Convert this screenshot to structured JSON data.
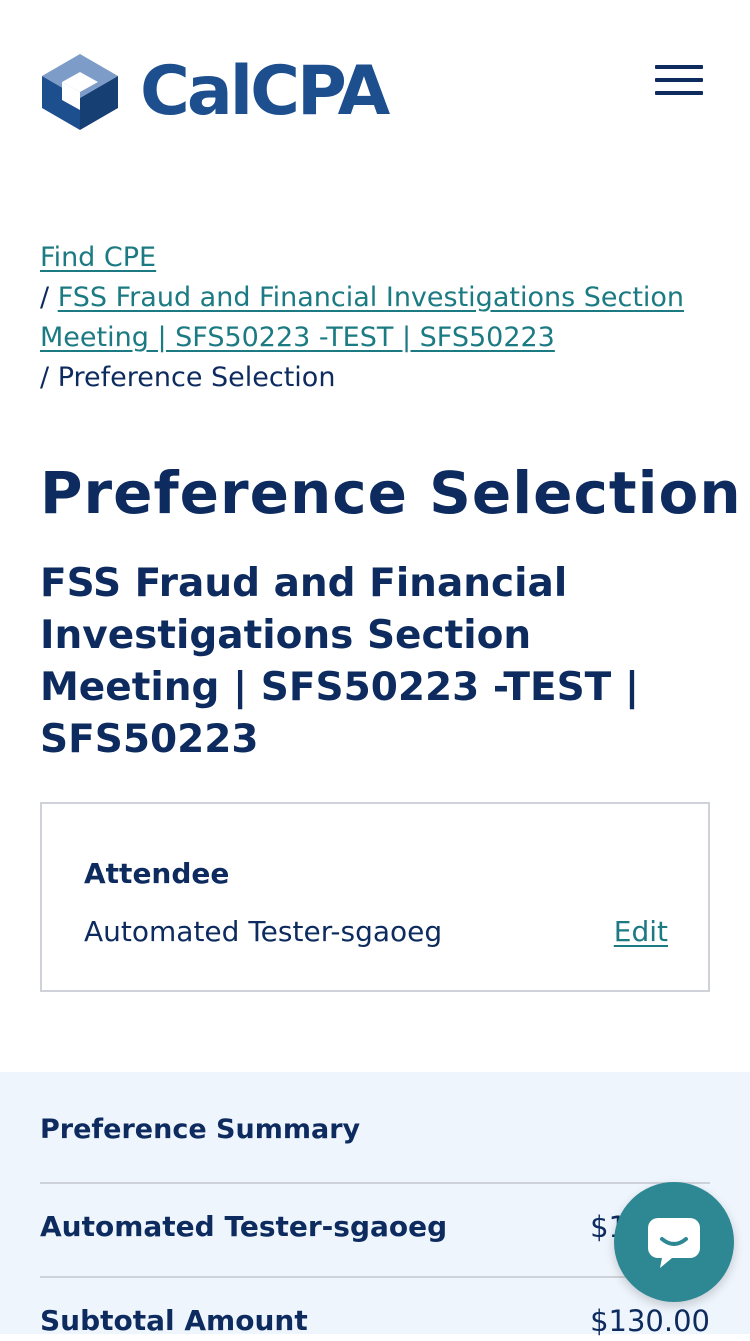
{
  "brand": {
    "name": "CalCPA",
    "logo_icon": "isometric-cube-logo",
    "primary_color": "#1d4f8f",
    "dark_text_color": "#0d2b5e",
    "link_color": "#1b7a82"
  },
  "header": {
    "menu_icon": "hamburger-menu-icon"
  },
  "breadcrumb": {
    "items": [
      {
        "label": "Find CPE",
        "is_link": true
      },
      {
        "label": "FSS Fraud and Financial Investigations Section Meeting | SFS50223 -TEST | SFS50223",
        "is_link": true
      },
      {
        "label": "Preference Selection",
        "is_link": false
      }
    ],
    "separator": "/"
  },
  "page": {
    "title": "Preference Selection",
    "event_title": "FSS Fraud and Financial Investigations Section Meeting | SFS50223 -TEST | SFS50223"
  },
  "attendee": {
    "heading": "Attendee",
    "name": "Automated Tester-sgaoeg",
    "edit_label": "Edit"
  },
  "summary": {
    "heading": "Preference Summary",
    "rows": [
      {
        "label": "Automated Tester-sgaoeg",
        "value": "$130.00"
      },
      {
        "label": "Subtotal Amount",
        "value": "$130.00"
      }
    ],
    "background_color": "#eff5fd"
  },
  "chat": {
    "icon": "chat-bubble-icon",
    "color": "#2e8894"
  }
}
